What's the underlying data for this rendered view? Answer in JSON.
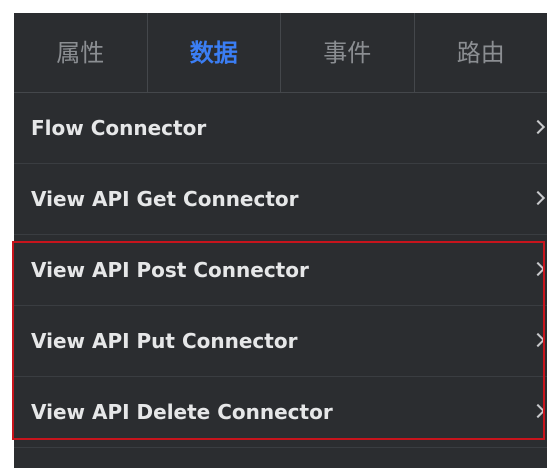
{
  "tabs": [
    {
      "label": "属性",
      "active": false
    },
    {
      "label": "数据",
      "active": true
    },
    {
      "label": "事件",
      "active": false
    },
    {
      "label": "路由",
      "active": false
    }
  ],
  "connectors": [
    {
      "label": "Flow Connector"
    },
    {
      "label": "View API Get Connector"
    },
    {
      "label": "View API Post Connector"
    },
    {
      "label": "View API Put Connector"
    },
    {
      "label": "View API Delete Connector"
    }
  ],
  "colors": {
    "panel_bg": "#2b2d30",
    "active_tab": "#3b7ef4",
    "highlight_border": "#c8141c"
  },
  "icons": {
    "row_arrow": "chevron-right-icon"
  }
}
